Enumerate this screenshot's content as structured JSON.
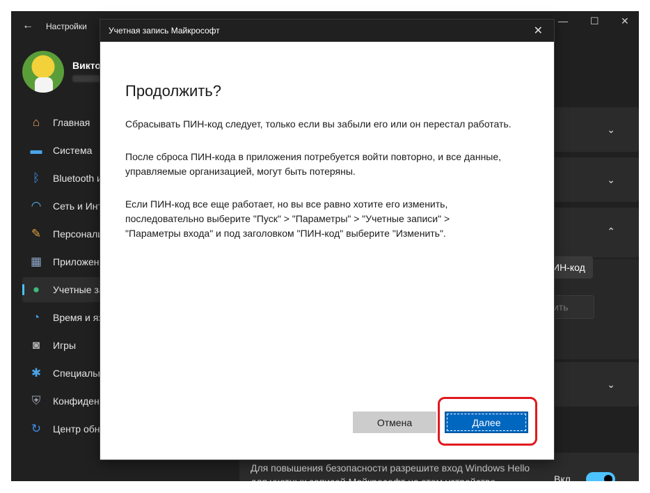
{
  "settings": {
    "app_title": "Настройки",
    "user_name": "Викто",
    "heading_fragment": "а",
    "nav": [
      {
        "label": "Главная",
        "icon": "home-icon"
      },
      {
        "label": "Система",
        "icon": "monitor-icon"
      },
      {
        "label": "Bluetooth и",
        "icon": "bluetooth-icon"
      },
      {
        "label": "Сеть и Инт",
        "icon": "wifi-icon"
      },
      {
        "label": "Персонали",
        "icon": "brush-icon"
      },
      {
        "label": "Приложен",
        "icon": "apps-icon"
      },
      {
        "label": "Учетные за",
        "icon": "person-icon"
      },
      {
        "label": "Время и яз",
        "icon": "clock-globe-icon"
      },
      {
        "label": "Игры",
        "icon": "gamepad-icon"
      },
      {
        "label": "Специальн",
        "icon": "accessibility-icon"
      },
      {
        "label": "Конфиден",
        "icon": "shield-icon"
      },
      {
        "label": "Центр обн",
        "icon": "update-icon"
      }
    ],
    "active_nav": 6,
    "pin_button_fragment": "ИН-код",
    "disabled_button_fragment": "ить",
    "hello_text_line1": "Для повышения безопасности разрешите вход Windows Hello",
    "hello_text_line2": "для учетных записей Майкрософт на этом устройстве",
    "toggle_label": "Вкл",
    "accent": "#4cc2ff"
  },
  "dialog": {
    "title": "Учетная запись Майкрософт",
    "heading": "Продолжить?",
    "para1": "Сбрасывать ПИН-код следует, только если вы забыли его или он перестал работать.",
    "para2": "После сброса ПИН-кода в приложения потребуется войти повторно, и все данные, управляемые организацией, могут быть потеряны.",
    "para3": "Если ПИН-код все еще работает, но вы все равно хотите его изменить, последовательно выберите \"Пуск\" > \"Параметры\" > \"Учетные записи\" > \"Параметры входа\" и под заголовком \"ПИН-код\" выберите \"Изменить\".",
    "cancel_label": "Отмена",
    "next_label": "Далее",
    "primary_color": "#0067c0",
    "highlight_color": "#e0191e"
  }
}
